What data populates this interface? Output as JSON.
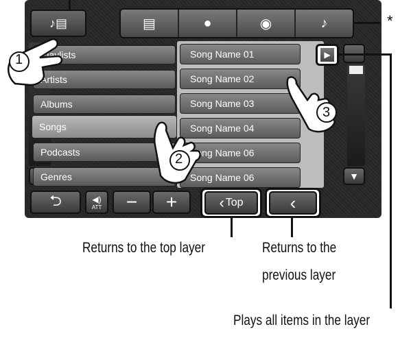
{
  "source_button_icon": "music-list-icon",
  "tabs": [
    {
      "icon": "list-icon",
      "glyph": "▤"
    },
    {
      "icon": "artist-icon",
      "glyph": "●"
    },
    {
      "icon": "album-icon",
      "glyph": "◉"
    },
    {
      "icon": "music-note-icon",
      "glyph": "♪"
    }
  ],
  "asterisk": "*",
  "categories": [
    "Playlists",
    "Artists",
    "Albums",
    "Songs",
    "Podcasts",
    "Genres"
  ],
  "selected_category": "Songs",
  "songs": [
    "Song Name 01",
    "Song Name 02",
    "Song Name 03",
    "Song Name 04",
    "Song Name 06",
    "Song Name 06"
  ],
  "bottom_bar": {
    "back_glyph": "⮌",
    "att_label": "ATT",
    "minus": "−",
    "plus": "+",
    "top_label": "Top",
    "prev_glyph": "‹"
  },
  "step_numbers": [
    "1",
    "2",
    "3"
  ],
  "annotations": {
    "top": "Returns to the top layer",
    "previous_line1": "Returns to the",
    "previous_line2": "previous layer",
    "play_all": "Plays all items in the layer"
  }
}
